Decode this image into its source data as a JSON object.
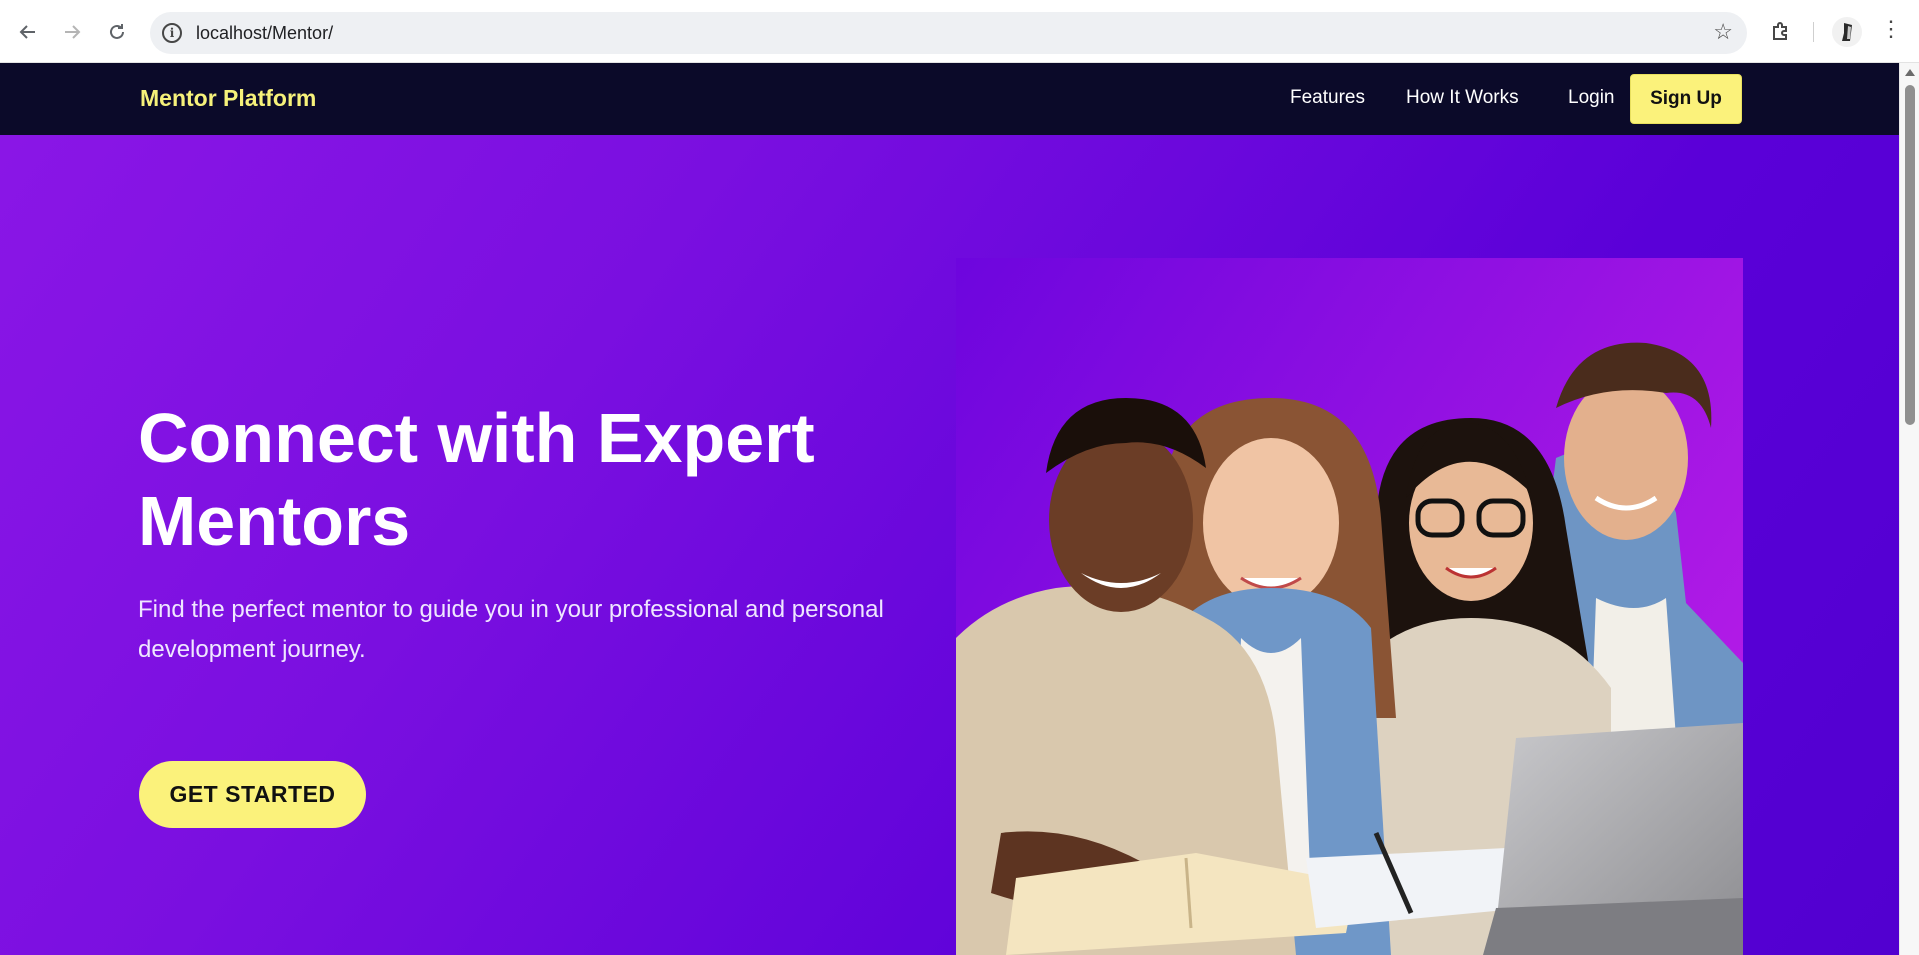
{
  "browser": {
    "url": "localhost/Mentor/"
  },
  "nav": {
    "brand": "Mentor Platform",
    "links": [
      "Features",
      "How It Works",
      "Login"
    ],
    "signup": "Sign Up"
  },
  "hero": {
    "title_line1": "Connect with Expert",
    "title_line2": "Mentors",
    "subtitle_line1": "Find the perfect mentor to guide you in your professional and personal",
    "subtitle_line2": "development journey.",
    "cta": "GET STARTED"
  },
  "colors": {
    "nav_bg": "#0b0a29",
    "accent_yellow": "#fbf27b",
    "hero_purple": "#6a05dc"
  }
}
